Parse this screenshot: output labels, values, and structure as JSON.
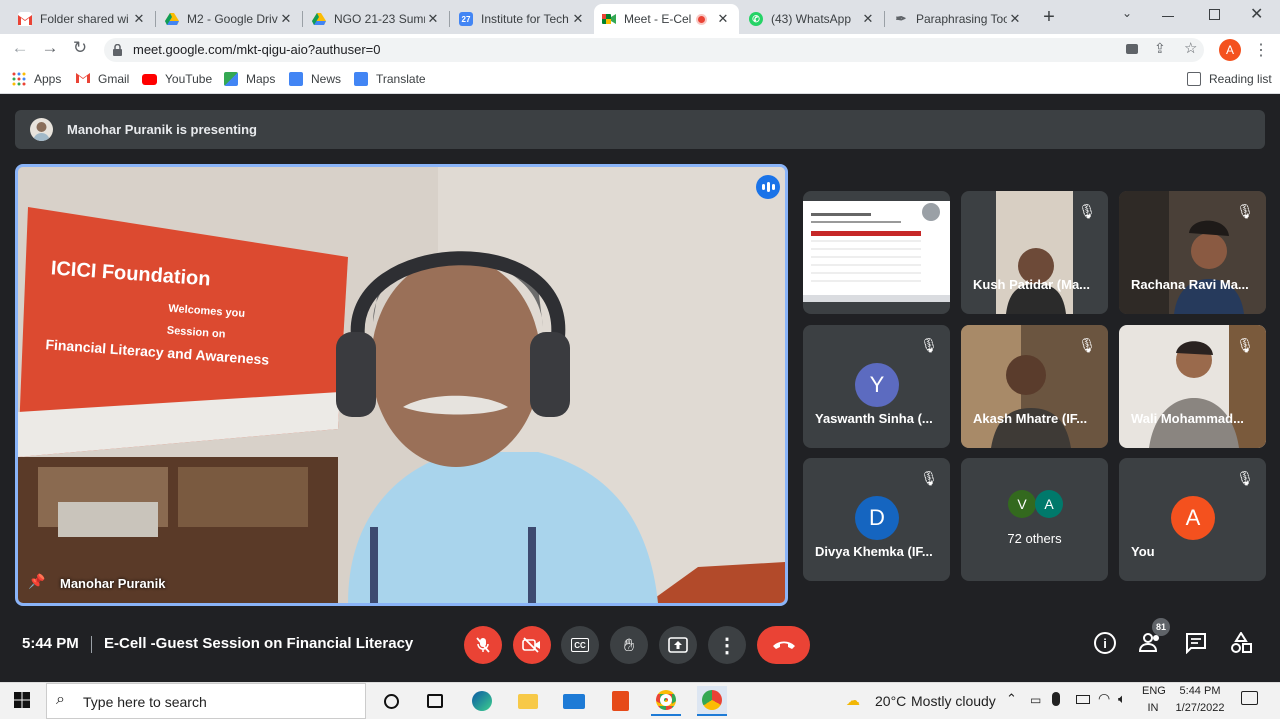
{
  "browser": {
    "tabs": [
      {
        "label": "Folder shared wi",
        "icon": "gmail-icon"
      },
      {
        "label": "M2 - Google Driv",
        "icon": "drive-icon"
      },
      {
        "label": "NGO 21-23 Summ",
        "icon": "drive-icon"
      },
      {
        "label": "Institute for Tech",
        "icon": "calendar-icon"
      },
      {
        "label": "Meet - E-Cel",
        "icon": "meet-icon"
      },
      {
        "label": "(43) WhatsApp",
        "icon": "whatsapp-icon"
      },
      {
        "label": "Paraphrasing Too",
        "icon": "quill-icon"
      }
    ],
    "url": "meet.google.com/mkt-qigu-aio?authuser=0",
    "profile_initial": "A",
    "bookmarks": [
      {
        "label": "Apps",
        "icon": "apps-grid-icon"
      },
      {
        "label": "Gmail",
        "icon": "gmail-icon"
      },
      {
        "label": "YouTube",
        "icon": "youtube-icon"
      },
      {
        "label": "Maps",
        "icon": "maps-icon"
      },
      {
        "label": "News",
        "icon": "news-icon"
      },
      {
        "label": "Translate",
        "icon": "translate-icon"
      }
    ],
    "reading_list": "Reading list"
  },
  "meet": {
    "banner": "Manohar Puranik is presenting",
    "main_speaker": "Manohar Puranik",
    "banner_signage": {
      "line1": "ICICI Foundation",
      "line2": "Welcomes you",
      "line3": "Session on",
      "line4": "Financial Literacy and Awareness"
    },
    "participants": [
      {
        "name": "Kush Patidar (Ma...",
        "type": "video"
      },
      {
        "name": "Rachana Ravi Ma...",
        "type": "video"
      },
      {
        "name": "Yaswanth Sinha (...",
        "type": "avatar",
        "initial": "Y",
        "color": "#5c6bc0"
      },
      {
        "name": "Akash Mhatre (IF...",
        "type": "video"
      },
      {
        "name": "Wali Mohammad...",
        "type": "video"
      },
      {
        "name": "Divya Khemka (IF...",
        "type": "avatar",
        "initial": "D",
        "color": "#1565c0"
      },
      {
        "name": "72 others",
        "type": "others",
        "initials": [
          "V",
          "A"
        ]
      },
      {
        "name": "You",
        "type": "avatar",
        "initial": "A",
        "color": "#f4511e"
      }
    ],
    "time": "5:44 PM",
    "meeting_title": "E-Cell -Guest Session on Financial Literacy",
    "participant_count": "81"
  },
  "taskbar": {
    "search_placeholder": "Type here to search",
    "temperature": "20°C",
    "weather": "Mostly cloudy",
    "lang_top": "ENG",
    "lang_bottom": "IN",
    "clock_time": "5:44 PM",
    "clock_date": "1/27/2022"
  },
  "colors": {
    "accent": "#8ab4f8",
    "danger": "#ea4335",
    "meet_bg": "#202124"
  }
}
